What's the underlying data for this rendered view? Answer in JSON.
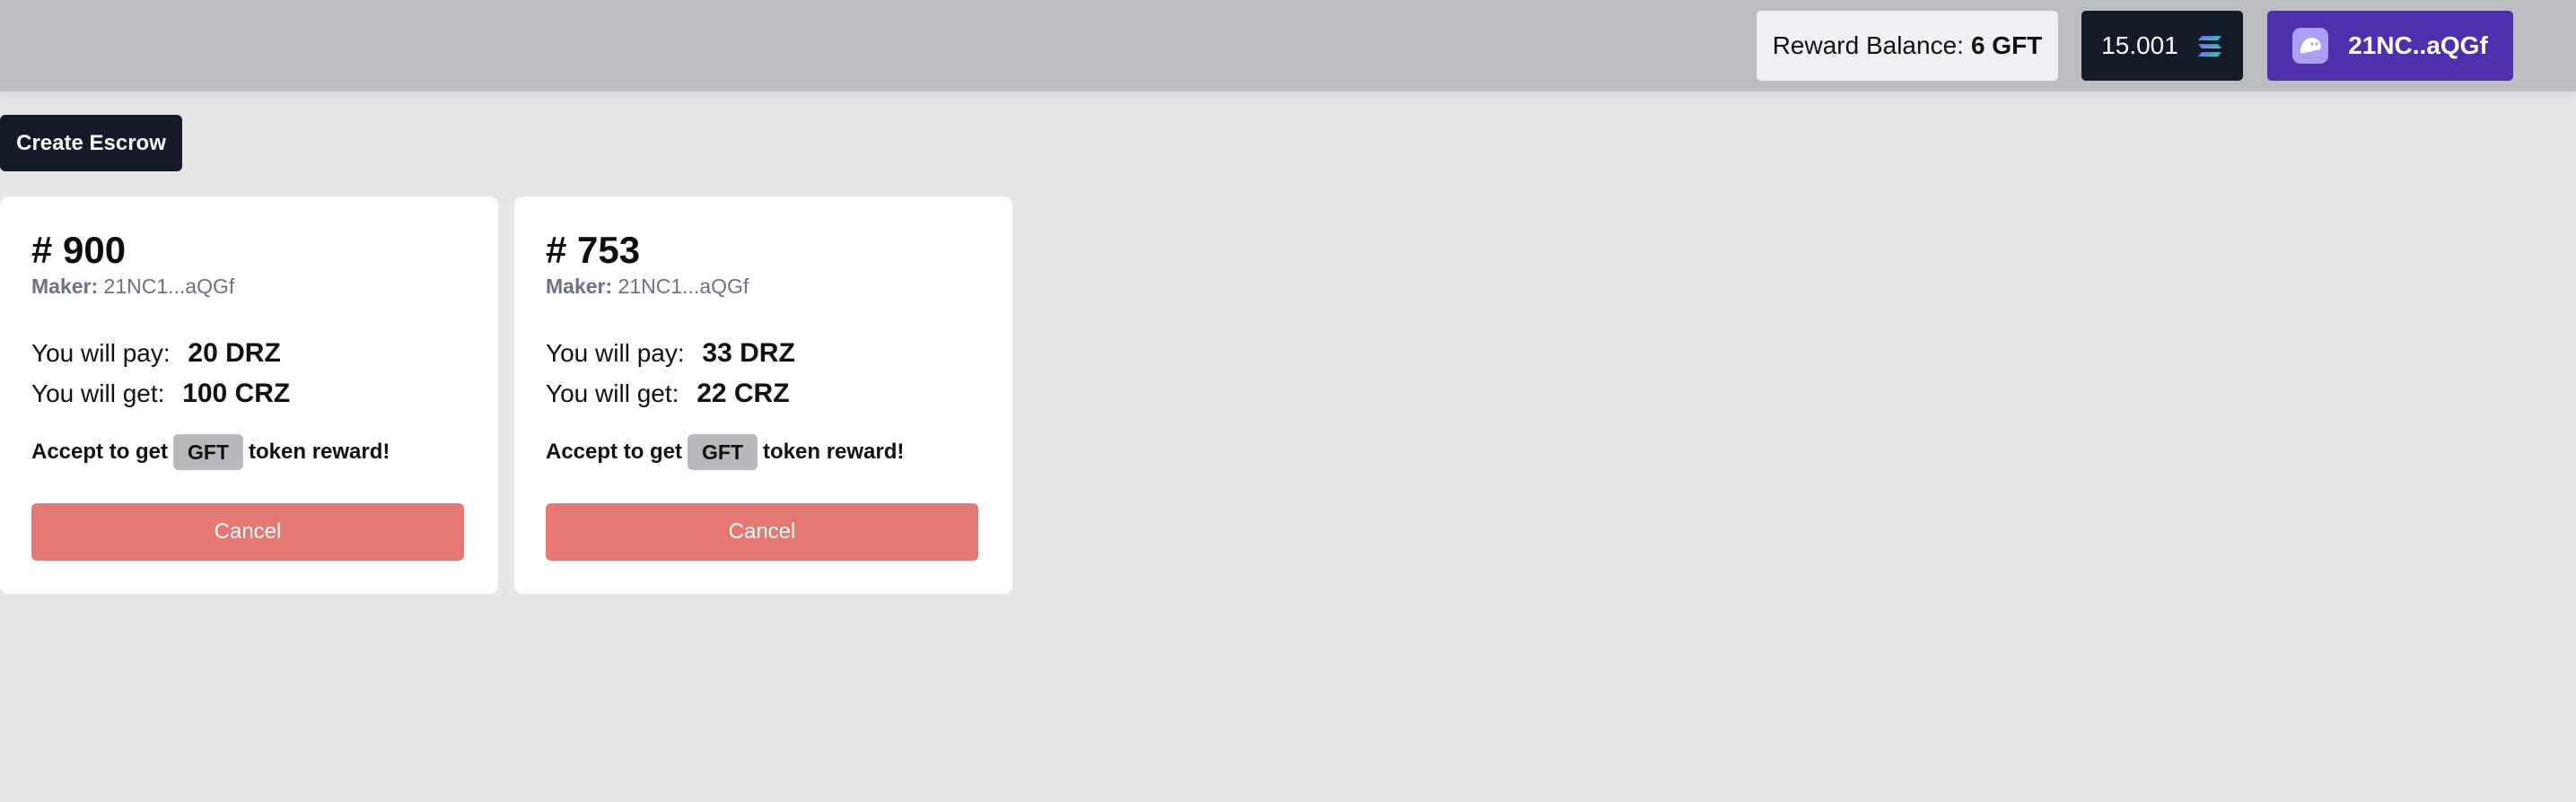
{
  "header": {
    "reward_label": "Reward Balance:",
    "reward_value": "6 GFT",
    "sol_balance": "15.001",
    "wallet_label": "21NC..aQGf"
  },
  "actions": {
    "create_label": "Create Escrow"
  },
  "escrows": [
    {
      "title": "# 900",
      "maker_label": "Maker:",
      "maker": "21NC1...aQGf",
      "pay_label": "You will pay:",
      "pay": "20 DRZ",
      "get_label": "You will get:",
      "get": "100 CRZ",
      "reward_prefix": "Accept to get",
      "reward_token": "GFT",
      "reward_suffix": "token reward!",
      "button_label": "Cancel"
    },
    {
      "title": "# 753",
      "maker_label": "Maker:",
      "maker": "21NC1...aQGf",
      "pay_label": "You will pay:",
      "pay": "33 DRZ",
      "get_label": "You will get:",
      "get": "22 CRZ",
      "reward_prefix": "Accept to get",
      "reward_token": "GFT",
      "reward_suffix": "token reward!",
      "button_label": "Cancel"
    }
  ],
  "colors": {
    "topbar": "#bbbdc1",
    "background": "#e5e6e8",
    "dark_button": "#151a2b",
    "wallet_button": "#4e2fac",
    "cancel_button": "#e57873"
  },
  "icons": {
    "sol": "solana-icon",
    "wallet": "phantom-ghost-icon"
  }
}
